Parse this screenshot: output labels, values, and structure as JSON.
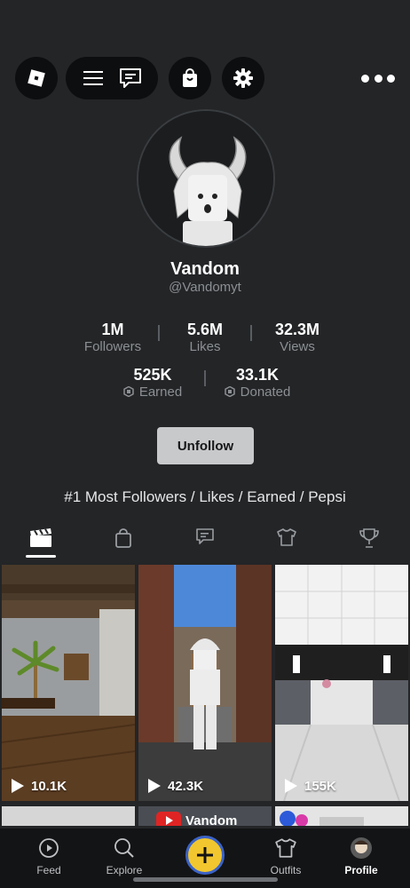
{
  "profile": {
    "display_name": "Vandom",
    "username": "@Vandomyt",
    "bio": "#1 Most Followers / Likes / Earned / Pepsi",
    "follow_button": "Unfollow"
  },
  "stats": [
    {
      "value": "1M",
      "label": "Followers"
    },
    {
      "value": "5.6M",
      "label": "Likes"
    },
    {
      "value": "32.3M",
      "label": "Views"
    }
  ],
  "robux_stats": [
    {
      "value": "525K",
      "label": "Earned"
    },
    {
      "value": "33.1K",
      "label": "Donated"
    }
  ],
  "tabs": [
    {
      "icon": "clapperboard-icon",
      "active": true
    },
    {
      "icon": "shopping-bag-icon",
      "active": false
    },
    {
      "icon": "chat-icon",
      "active": false
    },
    {
      "icon": "shirt-icon",
      "active": false
    },
    {
      "icon": "trophy-icon",
      "active": false
    }
  ],
  "videos": [
    {
      "views": "10.1K"
    },
    {
      "views": "42.3K"
    },
    {
      "views": "155K"
    }
  ],
  "partial_row": {
    "yt_label": "Vandom"
  },
  "nav": {
    "feed": "Feed",
    "explore": "Explore",
    "outfits": "Outfits",
    "profile": "Profile"
  },
  "colors": {
    "background": "#232527",
    "button": "#c8c9cb",
    "create_button": "#f2c62e"
  }
}
